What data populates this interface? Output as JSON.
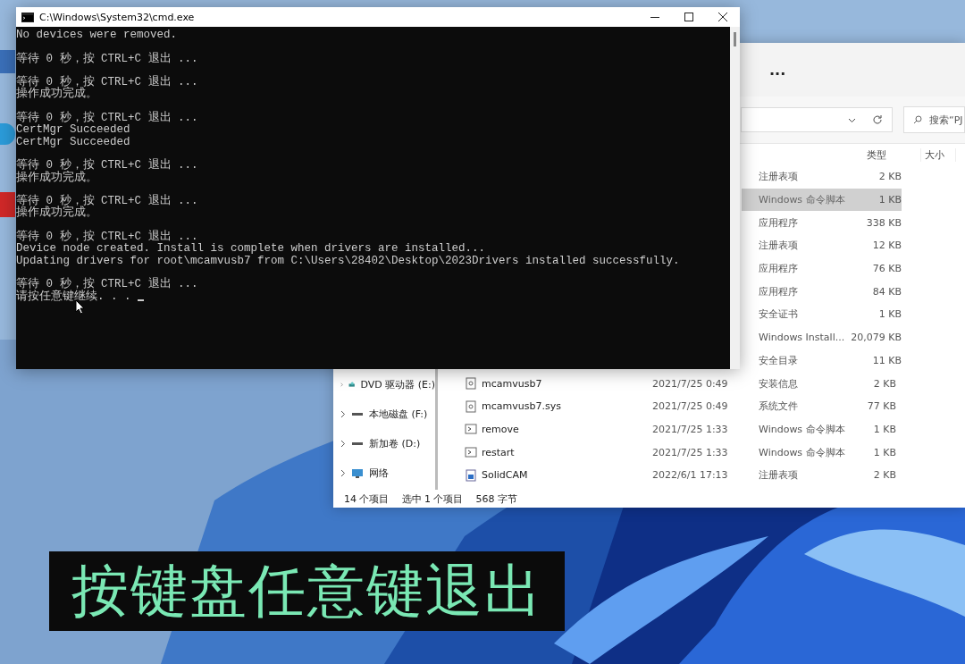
{
  "console": {
    "title": "C:\\Windows\\System32\\cmd.exe",
    "blocks": [
      [
        "No devices were removed."
      ],
      [
        "等待 0 秒，按 CTRL+C 退出 ..."
      ],
      [
        "等待 0 秒，按 CTRL+C 退出 ...",
        "操作成功完成。"
      ],
      [
        "等待 0 秒，按 CTRL+C 退出 ...",
        "CertMgr Succeeded",
        "CertMgr Succeeded"
      ],
      [
        "等待 0 秒，按 CTRL+C 退出 ...",
        "操作成功完成。"
      ],
      [
        "等待 0 秒，按 CTRL+C 退出 ...",
        "操作成功完成。"
      ],
      [
        "等待 0 秒，按 CTRL+C 退出 ...",
        "Device node created. Install is complete when drivers are installed...",
        "Updating drivers for root\\mcamvusb7 from C:\\Users\\28402\\Desktop\\2023Drivers installed successfully."
      ],
      [
        "等待 0 秒，按 CTRL+C 退出 ...",
        "请按任意键继续. . . "
      ]
    ]
  },
  "explorer": {
    "more_button": "...",
    "search": {
      "placeholder": "搜索“PJ"
    },
    "columns": [
      "类型",
      "大小"
    ],
    "nav_items": [
      {
        "kind": "dvd",
        "label": "DVD 驱动器 (E:)"
      },
      {
        "kind": "drive",
        "label": "本地磁盘 (F:)"
      },
      {
        "kind": "drive",
        "label": "新加卷 (D:)"
      },
      {
        "kind": "network",
        "label": "网络"
      }
    ],
    "rows": [
      {
        "type": "注册表项",
        "size": "2 KB",
        "selected": false
      },
      {
        "type": "Windows 命令脚本",
        "size": "1 KB",
        "selected": true
      },
      {
        "type": "应用程序",
        "size": "338 KB",
        "selected": false
      },
      {
        "type": "注册表项",
        "size": "12 KB",
        "selected": false
      },
      {
        "type": "应用程序",
        "size": "76 KB",
        "selected": false
      },
      {
        "type": "应用程序",
        "size": "84 KB",
        "selected": false
      },
      {
        "type": "安全证书",
        "size": "1 KB",
        "selected": false
      },
      {
        "type": "Windows Install...",
        "size": "20,079 KB",
        "selected": false
      },
      {
        "type": "安全目录",
        "size": "11 KB",
        "selected": false
      },
      {
        "kind": "file",
        "name": "mcamvusb7",
        "date": "2021/7/25 0:49",
        "type": "安装信息",
        "size": "2 KB",
        "selected": false
      },
      {
        "kind": "file",
        "name": "mcamvusb7.sys",
        "date": "2021/7/25 0:49",
        "type": "系统文件",
        "size": "77 KB",
        "selected": false
      },
      {
        "kind": "script",
        "name": "remove",
        "date": "2021/7/25 1:33",
        "type": "Windows 命令脚本",
        "size": "1 KB",
        "selected": false
      },
      {
        "kind": "script",
        "name": "restart",
        "date": "2021/7/25 1:33",
        "type": "Windows 命令脚本",
        "size": "1 KB",
        "selected": false
      },
      {
        "kind": "registry",
        "name": "SolidCAM",
        "date": "2022/6/1 17:13",
        "type": "注册表项",
        "size": "2 KB",
        "selected": false
      }
    ],
    "status": [
      "14 个项目",
      "选中 1 个项目",
      "568 字节"
    ]
  },
  "subtitle": "按键盘任意键退出"
}
